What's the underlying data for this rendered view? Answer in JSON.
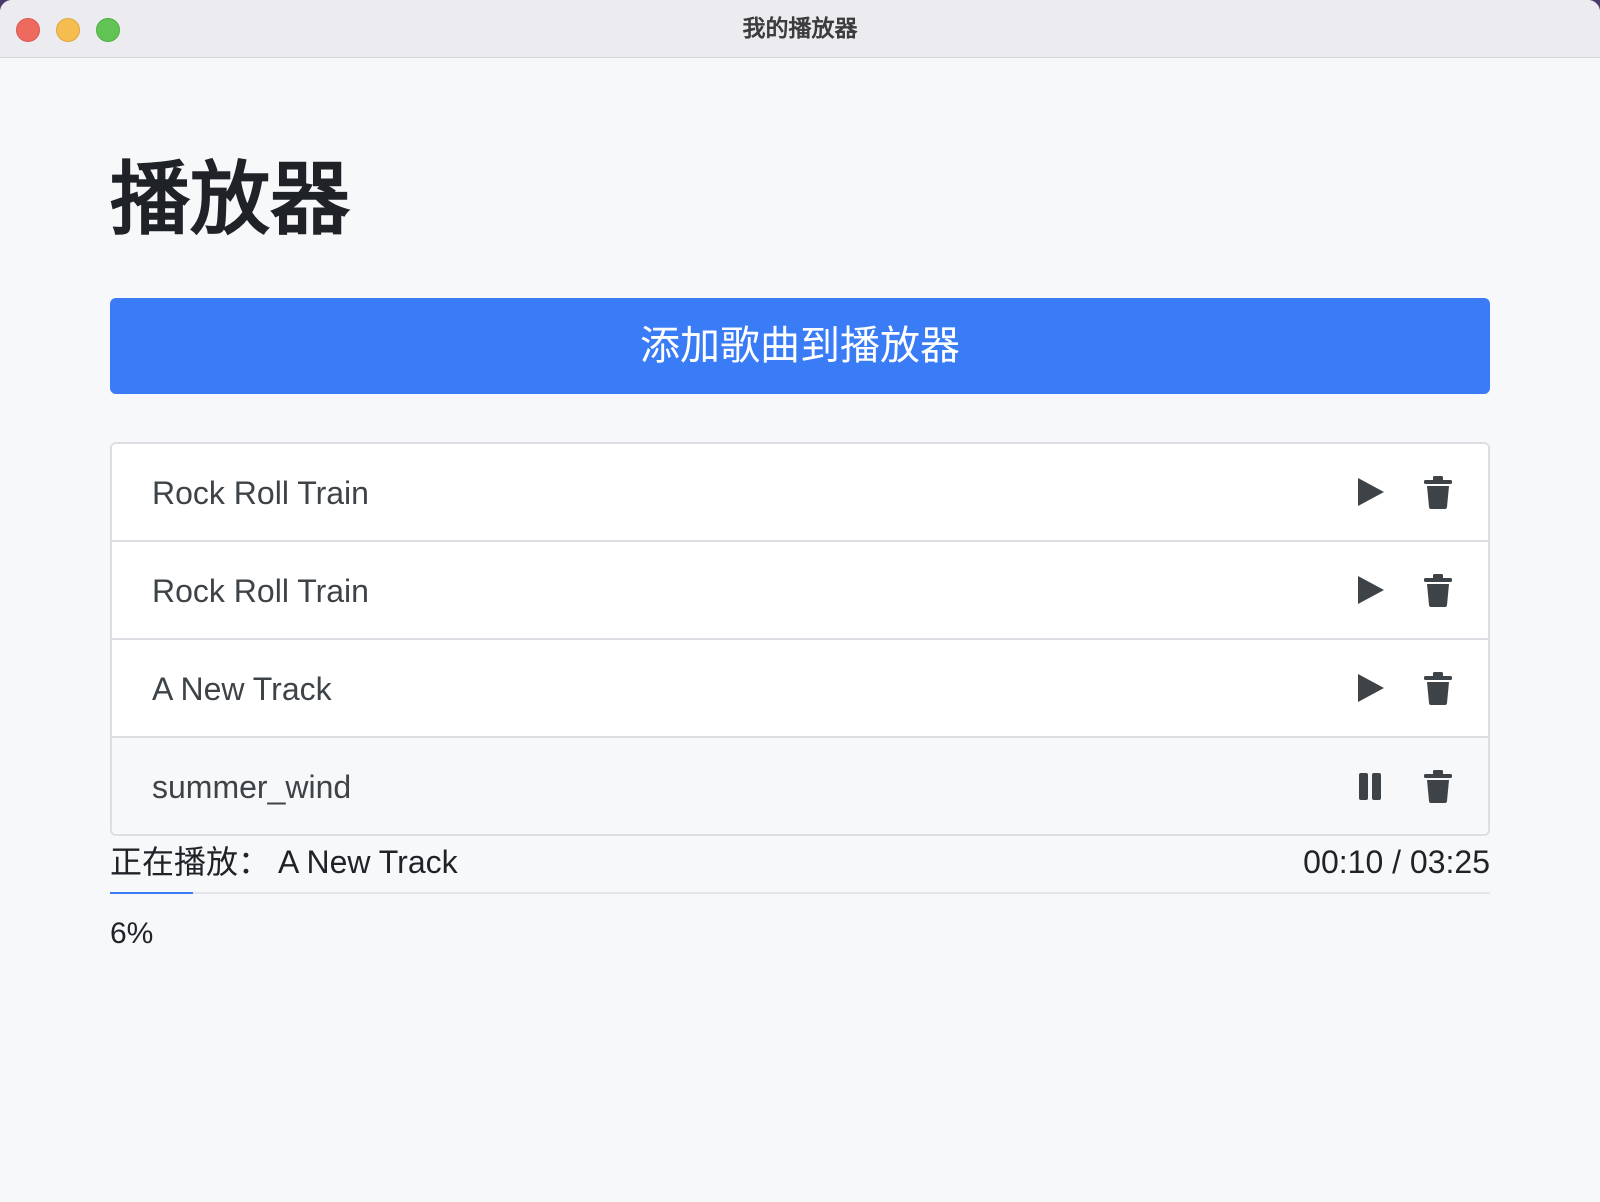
{
  "window": {
    "title": "我的播放器"
  },
  "page": {
    "heading": "播放器",
    "add_button_label": "添加歌曲到播放器"
  },
  "playlist": [
    {
      "title": "Rock Roll Train",
      "state": "play"
    },
    {
      "title": "Rock Roll Train",
      "state": "play"
    },
    {
      "title": "A New Track",
      "state": "play"
    },
    {
      "title": "summer_wind",
      "state": "pause"
    }
  ],
  "player": {
    "now_playing_label": "正在播放：",
    "now_playing_track": "A New Track",
    "time": "00:10 / 03:25",
    "progress_percent": 6,
    "progress_text": "6%"
  },
  "colors": {
    "accent": "#3a7bf6",
    "icon": "#3e4348"
  },
  "icons": {
    "play": "play-icon",
    "pause": "pause-icon",
    "delete": "trash-icon"
  }
}
